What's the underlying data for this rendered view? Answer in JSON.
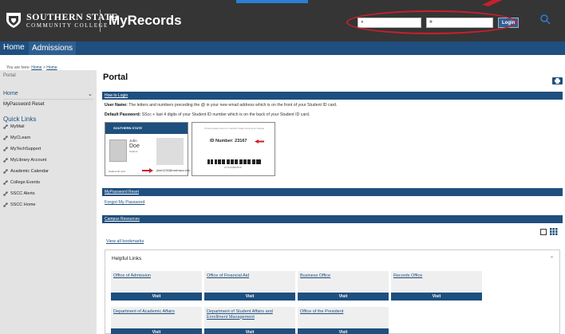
{
  "header": {
    "logo_line1": "SOUTHERN STATE",
    "logo_line2": "COMMUNITY COLLEGE",
    "app_title": "MyRecords",
    "login_button": "Login"
  },
  "nav": {
    "home": "Home",
    "admissions": "Admissions"
  },
  "breadcrumb": {
    "prefix": "You are here: ",
    "home1": "Home",
    "sep": " > ",
    "home2": "Home"
  },
  "sidebar": {
    "portal": "Portal",
    "home": "Home",
    "password_reset": "MyPassword Reset",
    "quick_links_heading": "Quick Links",
    "links": [
      "MyMail",
      "MyCLearn",
      "MyTechSupport",
      "MyLibrary Account",
      "Academic Calendar",
      "College Events",
      "SSCC Alerts",
      "SSCC Home"
    ]
  },
  "main": {
    "title": "Portal",
    "how_to_login": {
      "header": "How to Login",
      "username_label": "User Name:",
      "username_text": " The letters and numbers preceding the @ in your new email address which is on the front of your Student ID card.",
      "password_label": "Default Password:",
      "password_text": " SScc + last 4 digits of your Student ID number which is on the back of your Student ID card."
    },
    "card_front": {
      "brand": "SOUTHERN STATE",
      "first_name": "John",
      "last_name": "Doe",
      "role": "Student",
      "email": "jdoe1234@mail.sscc.edu",
      "id_label": "Student ID card"
    },
    "card_back": {
      "small_text": "If found please return to: Southern State Community College",
      "id_number": "ID Number: 23167",
      "barcode_number": "2771234567876"
    },
    "password_reset": {
      "header": "MyPassword Reset",
      "link": "Forgot My Password"
    },
    "campus_resources": {
      "header": "Campus Resources",
      "view_all": "View all bookmarks",
      "helpful_links_title": "Helpful Links",
      "visit_label": "Visit",
      "cards": [
        "Office of Admission",
        "Office of Financial Aid",
        "Business Office",
        "Records Office",
        "Department of Academic Affairs",
        "Department of Student Affairs and Enrollment Management",
        "Office of the President"
      ]
    }
  },
  "colors": {
    "header_bg": "#353535",
    "nav_bg": "#1e4f7e",
    "accent": "#1e4f7e",
    "highlight": "#c8202c"
  }
}
